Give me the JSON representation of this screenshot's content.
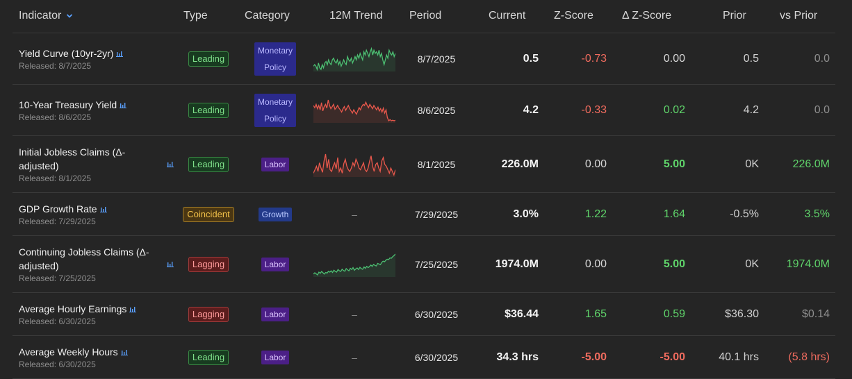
{
  "header": {
    "indicator": "Indicator",
    "type": "Type",
    "category": "Category",
    "trend": "12M Trend",
    "period": "Period",
    "current": "Current",
    "zscore": "Z-Score",
    "delta_zscore": "Δ Z-Score",
    "prior": "Prior",
    "vs_prior": "vs Prior"
  },
  "colors": {
    "positive": "#5fd36a",
    "negative": "#ef6b5e",
    "leading": "#7fe08a",
    "lagging": "#ff9b9b",
    "coincident": "#f3c24a",
    "sparkline_green": "#4cbf72",
    "sparkline_red": "#e9584c"
  },
  "rows": [
    {
      "title": "Yield Curve (10yr-2yr)",
      "released": "Released: 8/7/2025",
      "type": "Leading",
      "category": "Monetary Policy",
      "trend": {
        "color": "green",
        "values": [
          0.46,
          0.47,
          0.46,
          0.44,
          0.48,
          0.45,
          0.44,
          0.47,
          0.45,
          0.48,
          0.49,
          0.47,
          0.5,
          0.48,
          0.47,
          0.5,
          0.51,
          0.49,
          0.48,
          0.5,
          0.47,
          0.49,
          0.46,
          0.48,
          0.5,
          0.48,
          0.47,
          0.52,
          0.5,
          0.49,
          0.51,
          0.48,
          0.5,
          0.52,
          0.5,
          0.53,
          0.51,
          0.54,
          0.52,
          0.5,
          0.55,
          0.53,
          0.56,
          0.54,
          0.52,
          0.55,
          0.57,
          0.53,
          0.56,
          0.54,
          0.55,
          0.53,
          0.56,
          0.52,
          0.54,
          0.5,
          0.47,
          0.5,
          0.53,
          0.51,
          0.56,
          0.54,
          0.53,
          0.55,
          0.52,
          0.54
        ]
      },
      "period": "8/7/2025",
      "current": "0.5",
      "zscore": "-0.73",
      "zscore_class": "neg",
      "dz": "0.00",
      "dz_class": "neutral",
      "prior": "0.5",
      "vs": "0.0",
      "vs_class": "muted"
    },
    {
      "title": "10-Year Treasury Yield",
      "released": "Released: 8/6/2025",
      "type": "Leading",
      "category": "Monetary Policy",
      "trend": {
        "color": "red",
        "values": [
          4.5,
          4.46,
          4.52,
          4.44,
          4.5,
          4.42,
          4.55,
          4.4,
          4.48,
          4.52,
          4.45,
          4.6,
          4.5,
          4.44,
          4.48,
          4.52,
          4.43,
          4.46,
          4.5,
          4.45,
          4.42,
          4.38,
          4.44,
          4.48,
          4.41,
          4.46,
          4.5,
          4.44,
          4.4,
          4.36,
          4.42,
          4.38,
          4.34,
          4.4,
          4.46,
          4.42,
          4.48,
          4.52,
          4.5,
          4.56,
          4.5,
          4.46,
          4.52,
          4.48,
          4.44,
          4.5,
          4.46,
          4.42,
          4.47,
          4.4,
          4.44,
          4.38,
          4.45,
          4.36,
          4.42,
          4.28,
          4.22,
          4.24,
          4.22,
          4.23,
          4.22,
          4.23
        ]
      },
      "period": "8/6/2025",
      "current": "4.2",
      "zscore": "-0.33",
      "zscore_class": "neg",
      "dz": "0.02",
      "dz_class": "pos",
      "prior": "4.2",
      "vs": "0.0",
      "vs_class": "muted"
    },
    {
      "title": "Initial Jobless Claims (Δ-adjusted)",
      "detached_icon": true,
      "released": "Released: 8/1/2025",
      "type": "Leading",
      "category": "Labor",
      "trend": {
        "color": "red",
        "values": [
          224,
          228,
          232,
          226,
          236,
          230,
          225,
          238,
          246,
          230,
          240,
          228,
          226,
          232,
          236,
          229,
          242,
          226,
          230,
          224,
          235,
          240,
          232,
          228,
          226,
          230,
          236,
          232,
          240,
          236,
          230,
          228,
          232,
          236,
          228,
          226,
          230,
          238,
          244,
          232,
          226,
          234,
          236,
          230,
          226,
          238,
          242,
          234,
          232,
          228,
          224,
          230,
          226,
          222,
          228
        ]
      },
      "period": "8/1/2025",
      "current": "226.0M",
      "zscore": "0.00",
      "zscore_class": "neutral",
      "dz": "5.00",
      "dz_class": "pos",
      "dz_bold": true,
      "prior": "0K",
      "vs": "226.0M",
      "vs_class": "pos"
    },
    {
      "title": "GDP Growth Rate",
      "released": "Released: 7/29/2025",
      "type": "Coincident",
      "category": "Growth",
      "trend": null,
      "dash": "–",
      "period": "7/29/2025",
      "current": "3.0%",
      "zscore": "1.22",
      "zscore_class": "pos",
      "dz": "1.64",
      "dz_class": "pos",
      "prior": "-0.5%",
      "vs": "3.5%",
      "vs_class": "pos"
    },
    {
      "title": "Continuing Jobless Claims (Δ-adjusted)",
      "detached_icon": true,
      "released": "Released: 7/25/2025",
      "type": "Lagging",
      "category": "Labor",
      "trend": {
        "color": "green",
        "values": [
          1850,
          1858,
          1852,
          1845,
          1862,
          1855,
          1866,
          1858,
          1850,
          1860,
          1856,
          1868,
          1862,
          1870,
          1860,
          1874,
          1866,
          1862,
          1878,
          1870,
          1866,
          1880,
          1872,
          1868,
          1884,
          1876,
          1870,
          1886,
          1878,
          1890,
          1874,
          1882,
          1888,
          1878,
          1892,
          1884,
          1880,
          1894,
          1886,
          1898,
          1890,
          1896,
          1906,
          1898,
          1910,
          1904,
          1900,
          1916,
          1912,
          1908,
          1922,
          1930,
          1926,
          1936,
          1942,
          1940,
          1950,
          1948,
          1958,
          1965,
          1974
        ]
      },
      "period": "7/25/2025",
      "current": "1974.0M",
      "zscore": "0.00",
      "zscore_class": "neutral",
      "dz": "5.00",
      "dz_class": "pos",
      "dz_bold": true,
      "prior": "0K",
      "vs": "1974.0M",
      "vs_class": "pos"
    },
    {
      "title": "Average Hourly Earnings",
      "released": "Released: 6/30/2025",
      "type": "Lagging",
      "category": "Labor",
      "trend": null,
      "dash": "–",
      "period": "6/30/2025",
      "current": "$36.44",
      "zscore": "1.65",
      "zscore_class": "pos",
      "dz": "0.59",
      "dz_class": "pos",
      "prior": "$36.30",
      "vs": "$0.14",
      "vs_class": "muted"
    },
    {
      "title": "Average Weekly Hours",
      "released": "Released: 6/30/2025",
      "type": "Leading",
      "category": "Labor",
      "trend": null,
      "dash": "–",
      "period": "6/30/2025",
      "current": "34.3 hrs",
      "zscore": "-5.00",
      "zscore_class": "neg",
      "z_bold": true,
      "dz": "-5.00",
      "dz_class": "neg",
      "dz_bold": true,
      "prior": "40.1 hrs",
      "vs": "(5.8 hrs)",
      "vs_class": "neg"
    }
  ]
}
